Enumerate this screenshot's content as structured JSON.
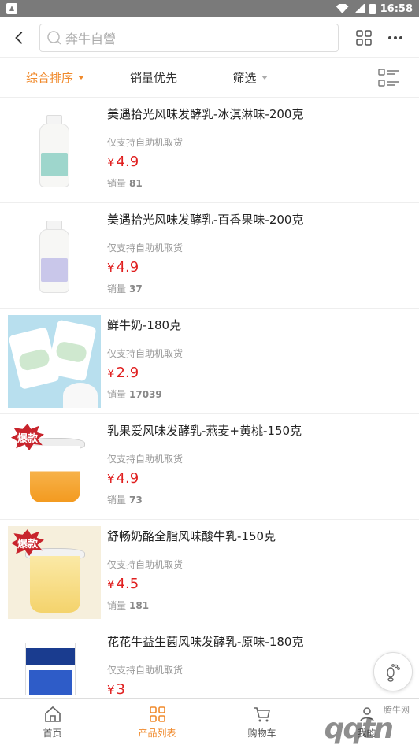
{
  "status_bar": {
    "time": "16:58"
  },
  "header": {
    "search_placeholder": "奔牛自營"
  },
  "sort_bar": {
    "comprehensive": "综合排序",
    "sales_first": "销量优先",
    "filter": "筛选"
  },
  "products": [
    {
      "title": "美遇拾光风味发酵乳-冰淇淋味-200克",
      "note": "仅支持自助机取货",
      "currency": "¥",
      "price": "4.9",
      "sales_label": "销量",
      "sales": "81",
      "image": "yogurt-bottle-green"
    },
    {
      "title": "美遇拾光风味发酵乳-百香果味-200克",
      "note": "仅支持自助机取货",
      "currency": "¥",
      "price": "4.9",
      "sales_label": "销量",
      "sales": "37",
      "image": "yogurt-bottle-purple"
    },
    {
      "title": "鲜牛奶-180克",
      "note": "仅支持自助机取货",
      "currency": "¥",
      "price": "2.9",
      "sales_label": "销量",
      "sales": "17039",
      "image": "milk-bags"
    },
    {
      "title": "乳果爱风味发酵乳-燕麦+黄桃-150克",
      "note": "仅支持自助机取货",
      "currency": "¥",
      "price": "4.9",
      "sales_label": "销量",
      "sales": "73",
      "image": "yogurt-cup-orange",
      "badge": "爆款"
    },
    {
      "title": "舒畅奶酪全脂风味酸牛乳-150克",
      "note": "仅支持自助机取货",
      "currency": "¥",
      "price": "4.5",
      "sales_label": "销量",
      "sales": "181",
      "image": "yogurt-cup-yellow",
      "badge": "爆款"
    },
    {
      "title": "花花牛益生菌风味发酵乳-原味-180克",
      "note": "仅支持自助机取货",
      "currency": "¥",
      "price": "3",
      "image": "yogurt-carton-blue"
    }
  ],
  "tab_bar": {
    "home": "首页",
    "product_list": "产品列表",
    "cart": "购物车",
    "mine": "我的"
  },
  "watermark": {
    "site": "腾牛网",
    "logo": "qqtn"
  },
  "colors": {
    "accent": "#f08a2c",
    "price": "#e02020",
    "badge": "#c8242c"
  }
}
